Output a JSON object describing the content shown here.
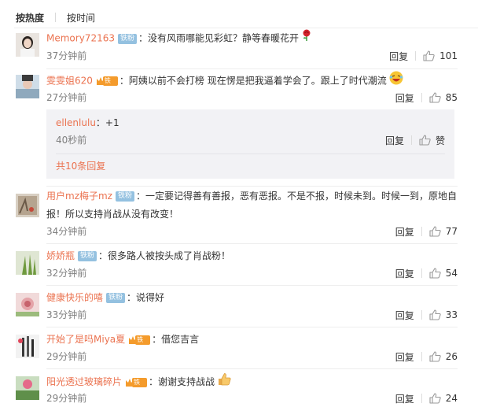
{
  "tabs": {
    "hot": "按热度",
    "time": "按时间"
  },
  "reply_label": "回复",
  "colors": {
    "username": "#eb7350",
    "badge_fans": "#94c1e0",
    "vip": "#f49b2c",
    "muted": "#808080"
  },
  "comments": [
    {
      "user": "Memory72163",
      "badge": "铁粉",
      "badge_type": "fans",
      "text": "：没有风雨哪能见彩虹？静等春暖花开",
      "emoji": "rose-icon",
      "time": "37分钟前",
      "likes": "101"
    },
    {
      "user": "雯雯姐620",
      "badge": "铁粉",
      "badge_type": "vip",
      "text": "：阿姨以前不会打榜 现在愣是把我逼着学会了。跟上了时代潮流",
      "emoji": "laughing-face-icon",
      "time": "27分钟前",
      "likes": "85"
    },
    {
      "user": "用户mz梅子mz",
      "badge": "铁粉",
      "badge_type": "fans",
      "text": "：一定要记得善有善报，恶有恶报。不是不报，时候未到。时候一到，原地自报！所以支持肖战从没有改变！",
      "time": "34分钟前",
      "likes": "77"
    },
    {
      "user": "娇娇瓶",
      "badge": "铁粉",
      "badge_type": "fans",
      "text": "：很多路人被按头成了肖战粉！",
      "time": "32分钟前",
      "likes": "54"
    },
    {
      "user": "健康快乐的嘻",
      "badge": "铁粉",
      "badge_type": "fans",
      "text": "：说得好",
      "time": "33分钟前",
      "likes": "33"
    },
    {
      "user": "开始了是吗Miya夏",
      "badge": "铁粉",
      "badge_type": "vip",
      "text": "：借您吉言",
      "time": "29分钟前",
      "likes": "26"
    },
    {
      "user": "阳光透过玻璃碎片",
      "badge": "铁粉",
      "badge_type": "vip",
      "text": "：谢谢支持战战",
      "emoji": "thumbs-up-emoji",
      "time": "29分钟前",
      "likes": "24"
    }
  ],
  "sub_reply": {
    "user": "ellenlulu",
    "text": "：+1",
    "time": "40秒前",
    "like_label": "赞",
    "more": "共10条回复"
  }
}
